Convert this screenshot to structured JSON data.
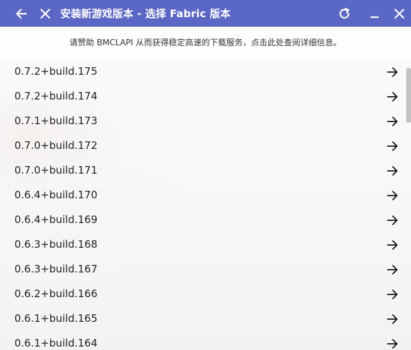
{
  "window": {
    "title": "安装新游戏版本 - 选择 Fabric 版本",
    "accent_color": "#5b67c4"
  },
  "titlebar": {
    "back_icon": "arrow-left-icon",
    "close_left_icon": "close-icon",
    "refresh_icon": "refresh-icon",
    "minimize_icon": "minimize-icon",
    "close_icon": "close-icon"
  },
  "notice": {
    "text": "请赞助 BMCLAPI 从而获得稳定高速的下载服务，点击此处查阅详细信息。"
  },
  "versions": [
    "0.7.2+build.175",
    "0.7.2+build.174",
    "0.7.1+build.173",
    "0.7.0+build.172",
    "0.7.0+build.171",
    "0.6.4+build.170",
    "0.6.4+build.169",
    "0.6.3+build.168",
    "0.6.3+build.167",
    "0.6.2+build.166",
    "0.6.1+build.165",
    "0.6.1+build.164"
  ],
  "item_action_icon": "arrow-right-icon"
}
